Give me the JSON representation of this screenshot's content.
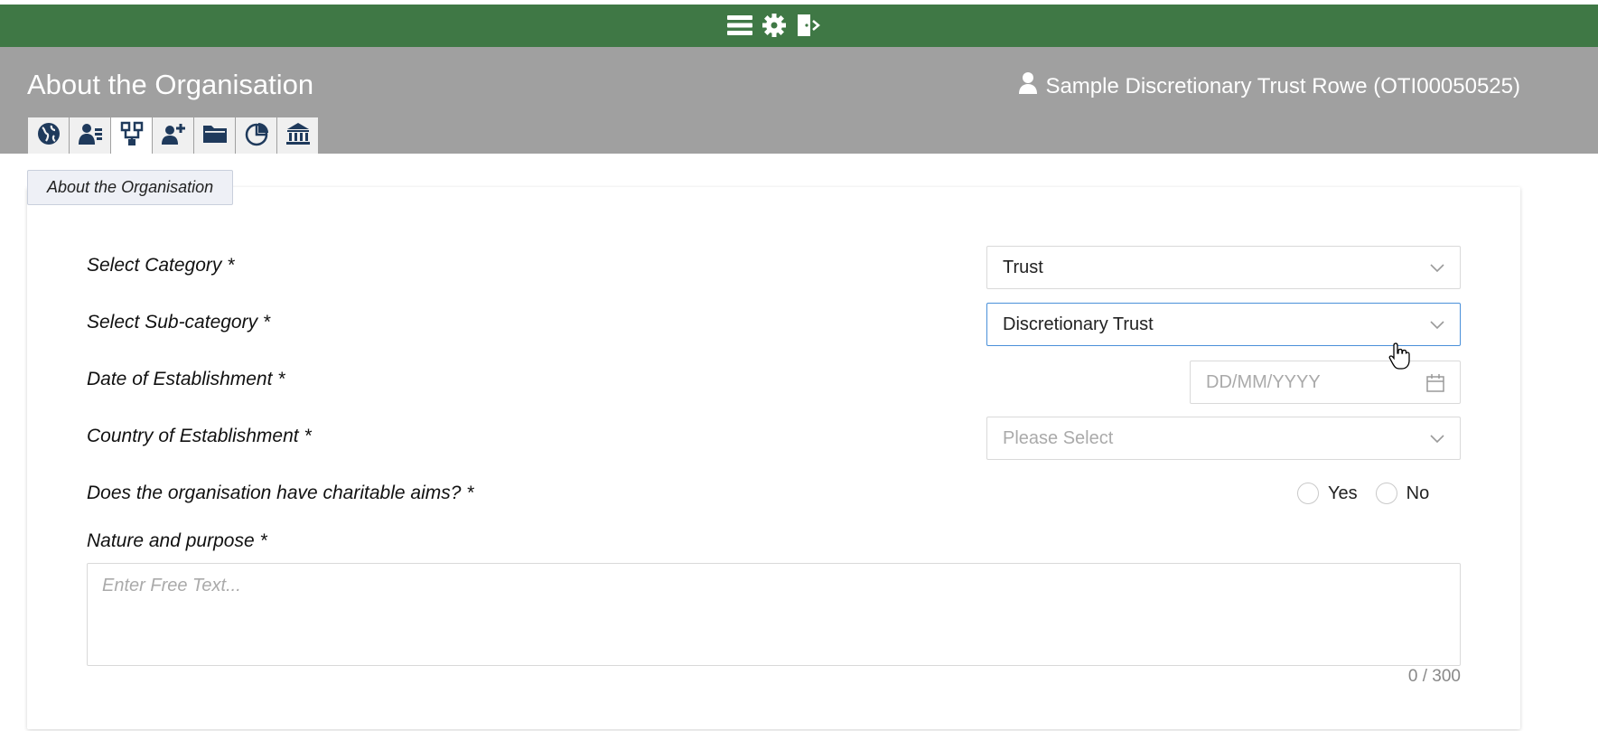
{
  "topbar": {
    "icons": [
      "menu-icon",
      "gear-icon",
      "logout-icon"
    ],
    "color": "#3f7845"
  },
  "header": {
    "title": "About the Organisation",
    "client_name": "Sample Discretionary Trust Rowe (OTI00050525)",
    "tabs": [
      {
        "icon": "globe-icon"
      },
      {
        "icon": "person-card-icon"
      },
      {
        "icon": "org-structure-icon"
      },
      {
        "icon": "add-person-icon"
      },
      {
        "icon": "folder-icon"
      },
      {
        "icon": "pie-chart-icon"
      },
      {
        "icon": "bank-icon"
      }
    ],
    "active_tab": 2
  },
  "section": {
    "label": "About the Organisation"
  },
  "form": {
    "category": {
      "label": "Select Category *",
      "value": "Trust"
    },
    "subcategory": {
      "label": "Select Sub-category *",
      "value": "Discretionary Trust"
    },
    "date": {
      "label": "Date of Establishment *",
      "placeholder": "DD/MM/YYYY"
    },
    "country": {
      "label": "Country of Establishment *",
      "placeholder": "Please Select"
    },
    "charitable": {
      "label": "Does the organisation have charitable aims? *",
      "yes": "Yes",
      "no": "No"
    },
    "nature": {
      "label": "Nature and purpose *",
      "placeholder": "Enter Free Text...",
      "counter": "0 / 300"
    }
  }
}
